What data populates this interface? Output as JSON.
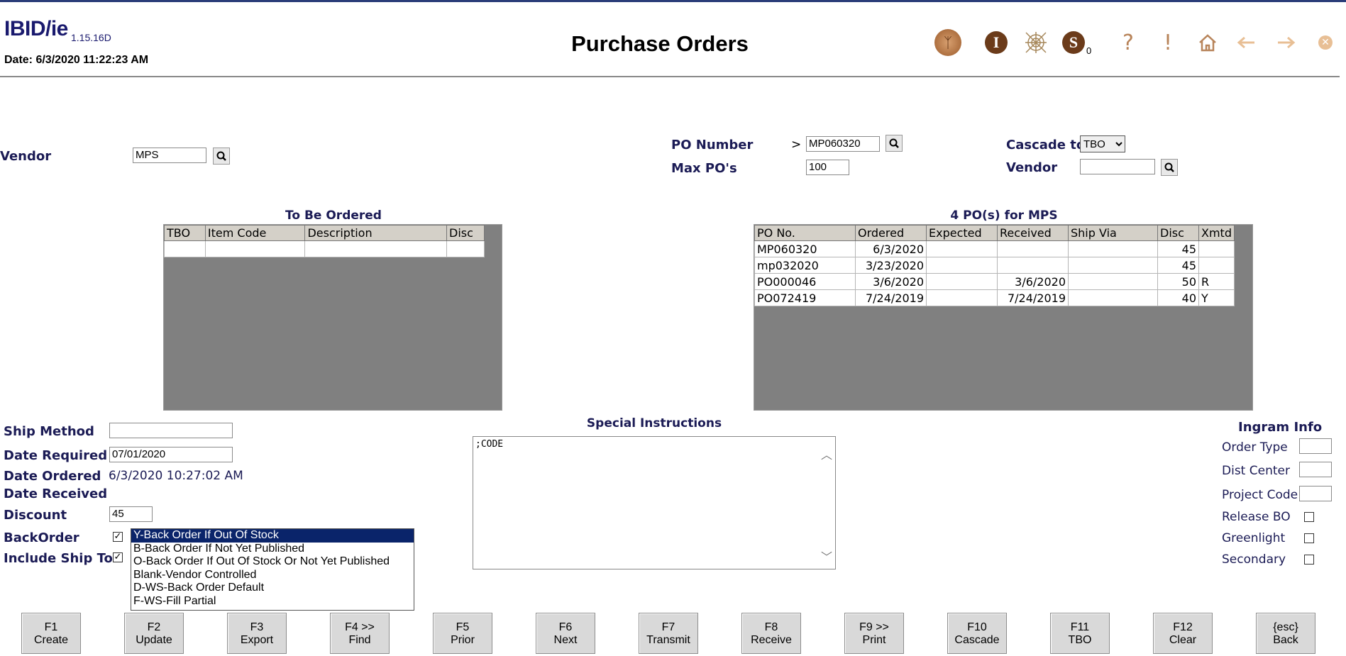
{
  "app": {
    "logo": "IBID/ie",
    "version": "1.15.16D",
    "datetime": "Date:  6/3/2020  11:22:23 AM",
    "title": "Purchase Orders"
  },
  "toolbar": {
    "s_badge": "0"
  },
  "vendor": {
    "label": "Vendor",
    "value": "MPS"
  },
  "po": {
    "number_label": "PO Number",
    "arrow": ">",
    "number_value": "MP060320",
    "max_label": "Max PO's",
    "max_value": "100",
    "cascade_label": "Cascade to",
    "cascade_value": "TBO",
    "vendor_label": "Vendor",
    "vendor_value": ""
  },
  "tbo": {
    "caption": "To Be Ordered",
    "columns": [
      "TBO",
      "Item Code",
      "Description",
      "Disc"
    ]
  },
  "pos": {
    "caption": "4 PO(s) for MPS",
    "columns": [
      "PO No.",
      "Ordered",
      "Expected",
      "Received",
      "Ship Via",
      "Disc",
      "Xmtd"
    ],
    "rows": [
      [
        "MP060320",
        "6/3/2020",
        "",
        "",
        "",
        "45",
        ""
      ],
      [
        "mp032020",
        "3/23/2020",
        "",
        "",
        "",
        "45",
        ""
      ],
      [
        "PO000046",
        "3/6/2020",
        "",
        "3/6/2020",
        "",
        "50",
        "R"
      ],
      [
        "PO072419",
        "7/24/2019",
        "",
        "7/24/2019",
        "",
        "40",
        "Y"
      ]
    ]
  },
  "details": {
    "ship_method_label": "Ship Method",
    "ship_method_value": "",
    "date_required_label": "Date Required",
    "date_required_value": "07/01/2020",
    "date_ordered_label": "Date Ordered",
    "date_ordered_value": "6/3/2020 10:27:02 AM",
    "date_received_label": "Date Received",
    "discount_label": "Discount",
    "discount_value": "45",
    "backorder_label": "BackOrder",
    "include_ship_label": "Include Ship To"
  },
  "backorder_options": [
    "Y-Back Order If Out Of Stock",
    "B-Back Order If Not Yet Published",
    "O-Back Order If Out Of Stock Or Not Yet Published",
    "Blank-Vendor Controlled",
    "D-WS-Back Order Default",
    "F-WS-Fill Partial"
  ],
  "special": {
    "label": "Special Instructions",
    "text": ";CODE"
  },
  "ingram": {
    "title": "Ingram Info",
    "order_type": "Order Type",
    "dist_center": "Dist Center",
    "project_code": "Project Code",
    "release_bo": "Release BO",
    "greenlight": "Greenlight",
    "secondary": "Secondary"
  },
  "fkeys": [
    {
      "key": "F1",
      "label": "Create"
    },
    {
      "key": "F2",
      "label": "Update"
    },
    {
      "key": "F3",
      "label": "Export"
    },
    {
      "key": "F4 >>",
      "label": "Find"
    },
    {
      "key": "F5",
      "label": "Prior"
    },
    {
      "key": "F6",
      "label": "Next"
    },
    {
      "key": "F7",
      "label": "Transmit"
    },
    {
      "key": "F8",
      "label": "Receive"
    },
    {
      "key": "F9 >>",
      "label": "Print"
    },
    {
      "key": "F10",
      "label": "Cascade"
    },
    {
      "key": "F11",
      "label": "TBO"
    },
    {
      "key": "F12",
      "label": "Clear"
    },
    {
      "key": "{esc}",
      "label": "Back"
    }
  ]
}
